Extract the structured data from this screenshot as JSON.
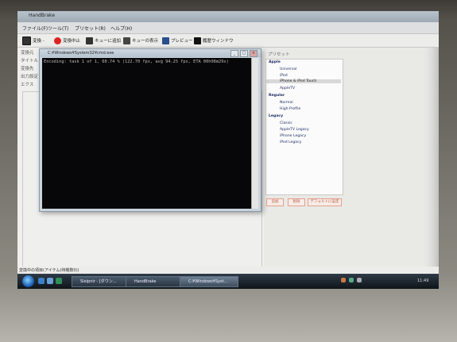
{
  "window": {
    "title": "HandBrake"
  },
  "menu": [
    "ファイル(F)",
    "ツール(T)",
    "プリセット(R)",
    "ヘルプ(H)"
  ],
  "toolbar": {
    "convert": "変換 -",
    "stop": "変換中止",
    "add_queue": "キューに追加",
    "show_queue": "キューの表示",
    "preview": "プレビュー",
    "activity": "履歴ウィンドウ"
  },
  "left_labels": [
    "変換元",
    "タイトル",
    "変換先",
    "出力設定",
    "エクス"
  ],
  "console": {
    "title": "C:¥Windows¥System32¥cmd.exe",
    "output": "Encoding: task 1 of 1, 60.74 % (122.70 fps, avg 94.25 fps, ETA 00h08m29s)"
  },
  "presets": {
    "label": "プリセット",
    "categories": [
      {
        "name": "Apple",
        "items": [
          "Universal",
          "iPod",
          "iPhone & iPod Touch",
          "AppleTV"
        ]
      },
      {
        "name": "Regular",
        "items": [
          "Normal",
          "High Profile"
        ]
      },
      {
        "name": "Legacy",
        "items": [
          "Classic",
          "AppleTV Legacy",
          "iPhone Legacy",
          "iPod Legacy"
        ]
      }
    ],
    "selected": "iPhone & iPod Touch",
    "buttons": [
      "追加",
      "削除",
      "デフォルトに設定"
    ]
  },
  "status_text": "変換中の項目(アイテム(待機数0))",
  "taskbar": {
    "tasks": [
      "Sleipnir - [ダウン...",
      "HandBrake",
      "C:¥Windows¥Syst..."
    ],
    "active": "C:¥Windows¥Syst...",
    "clock": "11:49"
  },
  "colors": {
    "console_bg": "#070709",
    "taskbar": "#1a232d",
    "accent": "#1d64b6"
  }
}
